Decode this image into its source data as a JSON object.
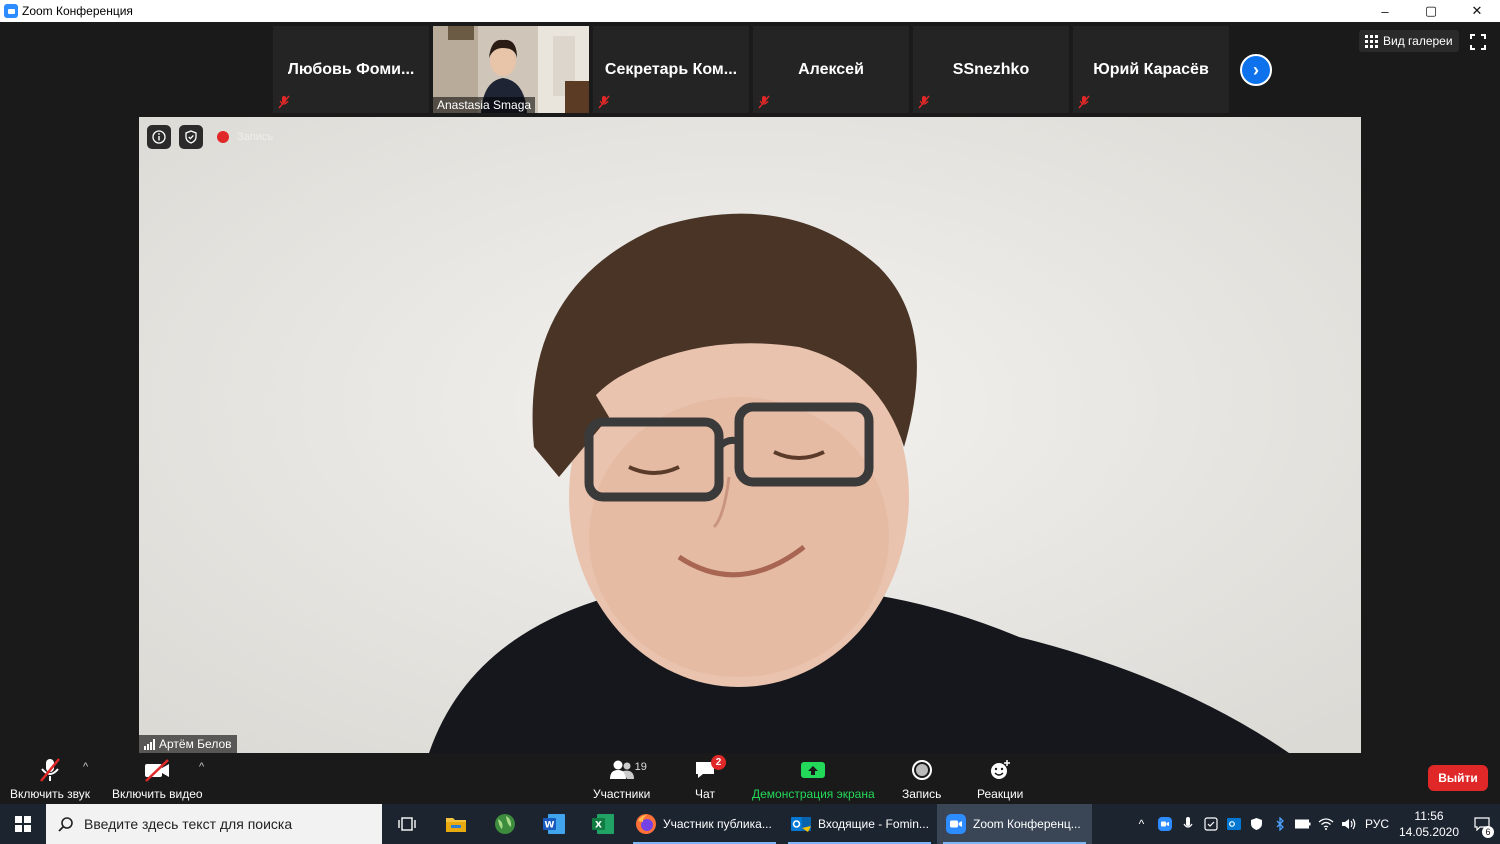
{
  "window": {
    "title": "Zoom Конференция",
    "controls": [
      "–",
      "▢",
      "✕"
    ]
  },
  "thumbnails": [
    {
      "name": "Любовь Фоми...",
      "muted": true,
      "video": false
    },
    {
      "name": "Anastasia Smaga",
      "muted": false,
      "video": true
    },
    {
      "name": "Секретарь Ком...",
      "muted": true,
      "video": false
    },
    {
      "name": "Алексей",
      "muted": true,
      "video": false
    },
    {
      "name": "SSnezhko",
      "muted": true,
      "video": false
    },
    {
      "name": "Юрий Карасёв",
      "muted": true,
      "video": false
    }
  ],
  "view": {
    "gallery_label": "Вид галереи"
  },
  "recording": {
    "label": "Запись"
  },
  "speaker": {
    "name": "Артём Белов"
  },
  "toolbar": {
    "audio_label": "Включить звук",
    "video_label": "Включить видео",
    "participants_label": "Участники",
    "participants_count": "19",
    "chat_label": "Чат",
    "chat_badge": "2",
    "share_label": "Демонстрация экрана",
    "record_label": "Запись",
    "reactions_label": "Реакции",
    "leave_label": "Выйти"
  },
  "taskbar": {
    "search_placeholder": "Введите здесь текст для поиска",
    "apps": [
      {
        "name": "Участник публика...",
        "icon": "firefox-icon"
      },
      {
        "name": "Входящие - Fomin...",
        "icon": "outlook-icon"
      },
      {
        "name": "Zoom Конференц...",
        "icon": "zoom-icon"
      }
    ],
    "language": "РУС",
    "time": "11:56",
    "date": "14.05.2020",
    "notifications": "6"
  },
  "colors": {
    "accent": "#2d8cff",
    "leave": "#e02828",
    "share": "#23d959",
    "taskbar": "#1c2430"
  }
}
